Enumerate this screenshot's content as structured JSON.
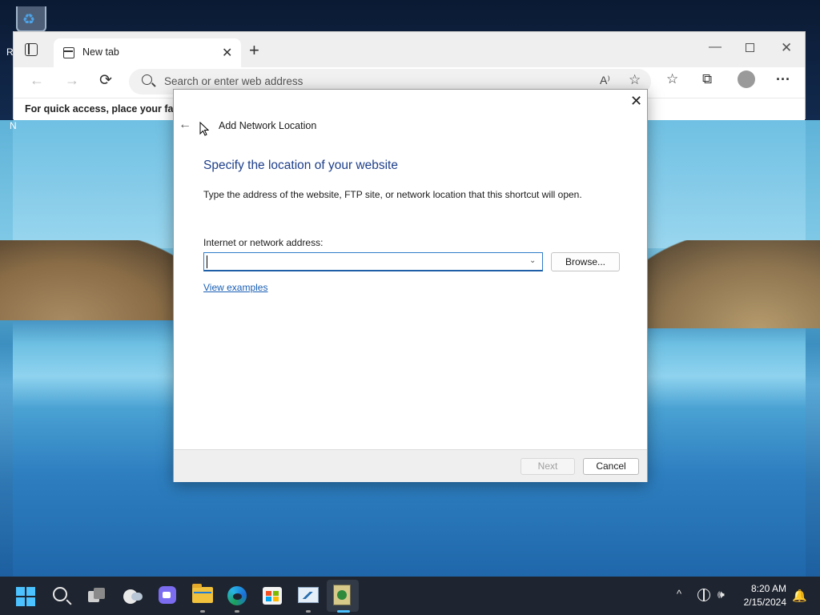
{
  "desktop": {
    "recycle_bin_label": "R",
    "side_label": "N"
  },
  "browser": {
    "tab": {
      "title": "New tab"
    },
    "address_bar": {
      "placeholder": "Search or enter web address"
    },
    "favorites_bar": {
      "message": "For quick access, place your favori"
    },
    "icons": {
      "tab_actions": "tab-actions-icon",
      "back": "←",
      "forward": "→",
      "refresh": "⟳",
      "read_aloud": "A⁾",
      "add_favorite": "☆",
      "favorites": "☆",
      "collections": "⧉",
      "more": "···",
      "new_tab": "+",
      "tab_close": "✕",
      "minimize": "—",
      "close": "✕"
    }
  },
  "dialog": {
    "title": "Add Network Location",
    "heading": "Specify the location of your website",
    "description": "Type the address of the website, FTP site, or network location that this shortcut will open.",
    "address_label": "Internet or network address:",
    "address_value": "",
    "browse_label": "Browse...",
    "view_examples_label": "View examples",
    "next_label": "Next",
    "cancel_label": "Cancel",
    "close_glyph": "✕",
    "back_glyph": "←",
    "dropdown_glyph": "⌄",
    "next_enabled": false
  },
  "taskbar": {
    "time": "8:20 AM",
    "date": "2/15/2024",
    "tray_chevron": "^",
    "volume_glyph": "🕪",
    "notify_glyph": "🔔",
    "accent_color": "#4cc2ff"
  }
}
